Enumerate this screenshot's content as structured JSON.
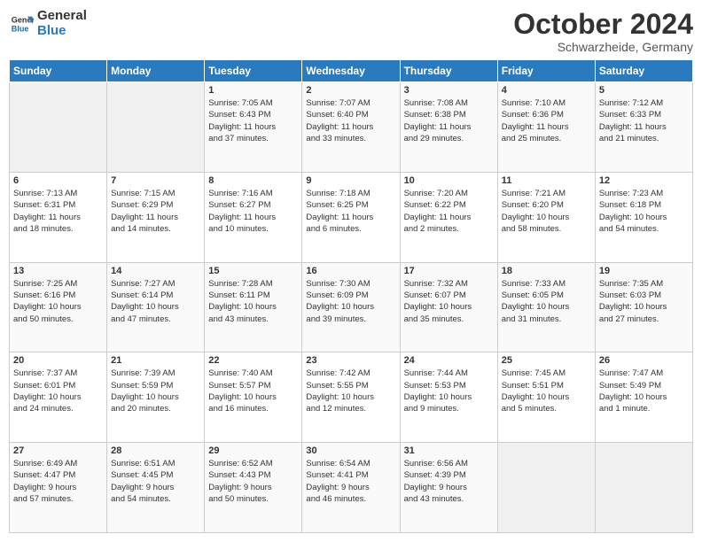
{
  "header": {
    "logo_line1": "General",
    "logo_line2": "Blue",
    "month": "October 2024",
    "location": "Schwarzheide, Germany"
  },
  "weekdays": [
    "Sunday",
    "Monday",
    "Tuesday",
    "Wednesday",
    "Thursday",
    "Friday",
    "Saturday"
  ],
  "weeks": [
    [
      {
        "day": "",
        "info": ""
      },
      {
        "day": "",
        "info": ""
      },
      {
        "day": "1",
        "info": "Sunrise: 7:05 AM\nSunset: 6:43 PM\nDaylight: 11 hours\nand 37 minutes."
      },
      {
        "day": "2",
        "info": "Sunrise: 7:07 AM\nSunset: 6:40 PM\nDaylight: 11 hours\nand 33 minutes."
      },
      {
        "day": "3",
        "info": "Sunrise: 7:08 AM\nSunset: 6:38 PM\nDaylight: 11 hours\nand 29 minutes."
      },
      {
        "day": "4",
        "info": "Sunrise: 7:10 AM\nSunset: 6:36 PM\nDaylight: 11 hours\nand 25 minutes."
      },
      {
        "day": "5",
        "info": "Sunrise: 7:12 AM\nSunset: 6:33 PM\nDaylight: 11 hours\nand 21 minutes."
      }
    ],
    [
      {
        "day": "6",
        "info": "Sunrise: 7:13 AM\nSunset: 6:31 PM\nDaylight: 11 hours\nand 18 minutes."
      },
      {
        "day": "7",
        "info": "Sunrise: 7:15 AM\nSunset: 6:29 PM\nDaylight: 11 hours\nand 14 minutes."
      },
      {
        "day": "8",
        "info": "Sunrise: 7:16 AM\nSunset: 6:27 PM\nDaylight: 11 hours\nand 10 minutes."
      },
      {
        "day": "9",
        "info": "Sunrise: 7:18 AM\nSunset: 6:25 PM\nDaylight: 11 hours\nand 6 minutes."
      },
      {
        "day": "10",
        "info": "Sunrise: 7:20 AM\nSunset: 6:22 PM\nDaylight: 11 hours\nand 2 minutes."
      },
      {
        "day": "11",
        "info": "Sunrise: 7:21 AM\nSunset: 6:20 PM\nDaylight: 10 hours\nand 58 minutes."
      },
      {
        "day": "12",
        "info": "Sunrise: 7:23 AM\nSunset: 6:18 PM\nDaylight: 10 hours\nand 54 minutes."
      }
    ],
    [
      {
        "day": "13",
        "info": "Sunrise: 7:25 AM\nSunset: 6:16 PM\nDaylight: 10 hours\nand 50 minutes."
      },
      {
        "day": "14",
        "info": "Sunrise: 7:27 AM\nSunset: 6:14 PM\nDaylight: 10 hours\nand 47 minutes."
      },
      {
        "day": "15",
        "info": "Sunrise: 7:28 AM\nSunset: 6:11 PM\nDaylight: 10 hours\nand 43 minutes."
      },
      {
        "day": "16",
        "info": "Sunrise: 7:30 AM\nSunset: 6:09 PM\nDaylight: 10 hours\nand 39 minutes."
      },
      {
        "day": "17",
        "info": "Sunrise: 7:32 AM\nSunset: 6:07 PM\nDaylight: 10 hours\nand 35 minutes."
      },
      {
        "day": "18",
        "info": "Sunrise: 7:33 AM\nSunset: 6:05 PM\nDaylight: 10 hours\nand 31 minutes."
      },
      {
        "day": "19",
        "info": "Sunrise: 7:35 AM\nSunset: 6:03 PM\nDaylight: 10 hours\nand 27 minutes."
      }
    ],
    [
      {
        "day": "20",
        "info": "Sunrise: 7:37 AM\nSunset: 6:01 PM\nDaylight: 10 hours\nand 24 minutes."
      },
      {
        "day": "21",
        "info": "Sunrise: 7:39 AM\nSunset: 5:59 PM\nDaylight: 10 hours\nand 20 minutes."
      },
      {
        "day": "22",
        "info": "Sunrise: 7:40 AM\nSunset: 5:57 PM\nDaylight: 10 hours\nand 16 minutes."
      },
      {
        "day": "23",
        "info": "Sunrise: 7:42 AM\nSunset: 5:55 PM\nDaylight: 10 hours\nand 12 minutes."
      },
      {
        "day": "24",
        "info": "Sunrise: 7:44 AM\nSunset: 5:53 PM\nDaylight: 10 hours\nand 9 minutes."
      },
      {
        "day": "25",
        "info": "Sunrise: 7:45 AM\nSunset: 5:51 PM\nDaylight: 10 hours\nand 5 minutes."
      },
      {
        "day": "26",
        "info": "Sunrise: 7:47 AM\nSunset: 5:49 PM\nDaylight: 10 hours\nand 1 minute."
      }
    ],
    [
      {
        "day": "27",
        "info": "Sunrise: 6:49 AM\nSunset: 4:47 PM\nDaylight: 9 hours\nand 57 minutes."
      },
      {
        "day": "28",
        "info": "Sunrise: 6:51 AM\nSunset: 4:45 PM\nDaylight: 9 hours\nand 54 minutes."
      },
      {
        "day": "29",
        "info": "Sunrise: 6:52 AM\nSunset: 4:43 PM\nDaylight: 9 hours\nand 50 minutes."
      },
      {
        "day": "30",
        "info": "Sunrise: 6:54 AM\nSunset: 4:41 PM\nDaylight: 9 hours\nand 46 minutes."
      },
      {
        "day": "31",
        "info": "Sunrise: 6:56 AM\nSunset: 4:39 PM\nDaylight: 9 hours\nand 43 minutes."
      },
      {
        "day": "",
        "info": ""
      },
      {
        "day": "",
        "info": ""
      }
    ]
  ]
}
